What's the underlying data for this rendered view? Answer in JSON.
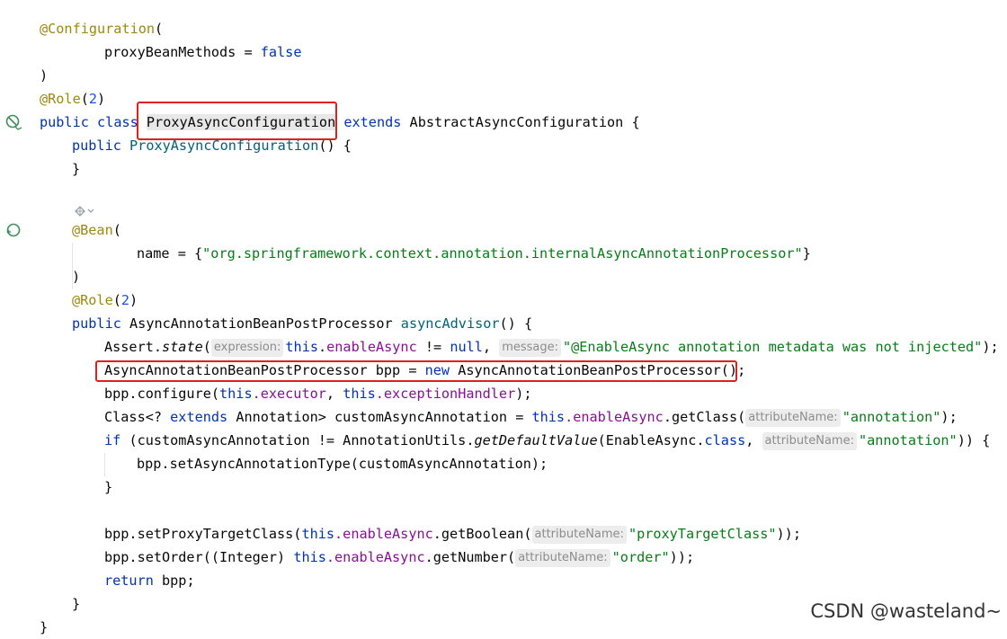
{
  "code": {
    "l1_annotation": "@Configuration",
    "l1_paren": "(",
    "l2_param": "proxyBeanMethods",
    "l2_eq": " = ",
    "l2_val": "false",
    "l3": ")",
    "l4_annotation": "@Role",
    "l4_open": "(",
    "l4_num": "2",
    "l4_close": ")",
    "l5_public": "public",
    "l5_class": "class",
    "l5_name": "ProxyAsyncConfiguration",
    "l5_extends": "extends",
    "l5_super": "AbstractAsyncConfiguration",
    "l5_brace": " {",
    "l6_public": "public",
    "l6_name": "ProxyAsyncConfiguration",
    "l6_rest": "() {",
    "l7": "}",
    "l9_annotation": "@Bean",
    "l9_paren": "(",
    "l10_param": "name",
    "l10_eq": " = {",
    "l10_str": "\"org.springframework.context.annotation.internalAsyncAnnotationProcessor\"",
    "l10_close": "}",
    "l11": ")",
    "l12_annotation": "@Role",
    "l12_open": "(",
    "l12_num": "2",
    "l12_close": ")",
    "l13_public": "public",
    "l13_type": "AsyncAnnotationBeanPostProcessor",
    "l13_method": "asyncAdvisor",
    "l13_rest": "() {",
    "l14_assert": "Assert.",
    "l14_state": "state",
    "l14_open": "(",
    "l14_hint1": "expression:",
    "l14_this": "this",
    "l14_dot": ".",
    "l14_field": "enableAsync",
    "l14_ne": " != ",
    "l14_null": "null",
    "l14_comma": ", ",
    "l14_hint2": "message:",
    "l14_msg": "\"@EnableAsync annotation metadata was not injected\"",
    "l14_end": ");",
    "l15_type": "AsyncAnnotationBeanPostProcessor bpp = ",
    "l15_new": "new",
    "l15_rest": " AsyncAnnotationBeanPostProcessor();",
    "l16_a": "bpp.configure(",
    "l16_this1": "this",
    "l16_f1": ".executor",
    "l16_comma": ", ",
    "l16_this2": "this",
    "l16_f2": ".exceptionHandler",
    "l16_end": ");",
    "l17_a": "Class<? ",
    "l17_extends": "extends",
    "l17_b": " Annotation> customAsyncAnnotation = ",
    "l17_this": "this",
    "l17_f": ".enableAsync",
    "l17_c": ".getClass(",
    "l17_hint": "attributeName:",
    "l17_str": "\"annotation\"",
    "l17_end": ");",
    "l18_if": "if",
    "l18_a": " (customAsyncAnnotation != AnnotationUtils.",
    "l18_m": "getDefaultValue",
    "l18_b": "(EnableAsync.",
    "l18_class": "class",
    "l18_c": ", ",
    "l18_hint": "attributeName:",
    "l18_str": "\"annotation\"",
    "l18_end": ")) {",
    "l19": "bpp.setAsyncAnnotationType(customAsyncAnnotation);",
    "l20": "}",
    "l22_a": "bpp.setProxyTargetClass(",
    "l22_this": "this",
    "l22_f": ".enableAsync",
    "l22_b": ".getBoolean(",
    "l22_hint": "attributeName:",
    "l22_str": "\"proxyTargetClass\"",
    "l22_end": "));",
    "l23_a": "bpp.setOrder((Integer) ",
    "l23_this": "this",
    "l23_f": ".enableAsync",
    "l23_b": ".getNumber(",
    "l23_hint": "attributeName:",
    "l23_str": "\"order\"",
    "l23_end": "));",
    "l24_return": "return",
    "l24_rest": " bpp;",
    "l25": "}",
    "l26": "}"
  },
  "watermark": "CSDN @wasteland~",
  "colors": {
    "highlight_box": "#e0201a",
    "keyword": "#0033b3",
    "string": "#067d17",
    "annotation": "#9e880d",
    "field": "#871094"
  }
}
